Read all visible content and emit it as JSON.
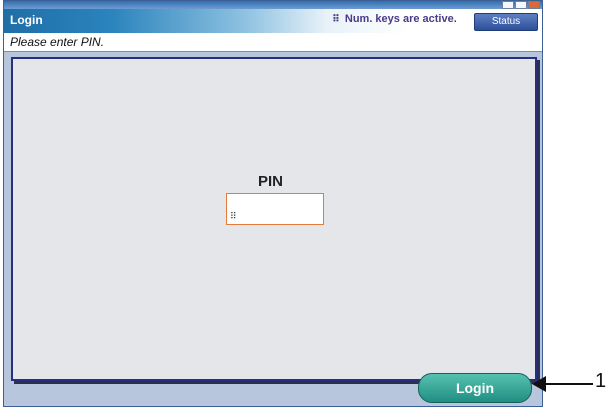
{
  "window": {
    "title": "Login",
    "num_keys_notice": "Num. keys are active.",
    "status_label": "Status",
    "message": "Please enter PIN."
  },
  "login_panel": {
    "pin_label": "PIN",
    "pin_value": "",
    "login_label": "Login"
  },
  "callout": {
    "number": "1"
  },
  "colors": {
    "accent": "#1f6ea7",
    "login_button": "#2aa492",
    "pin_border": "#e67a3a",
    "panel_bg": "#e4e6ea"
  },
  "icons": [
    "keypad-icon",
    "minimize-icon",
    "maximize-icon",
    "close-icon",
    "arrow-icon"
  ]
}
